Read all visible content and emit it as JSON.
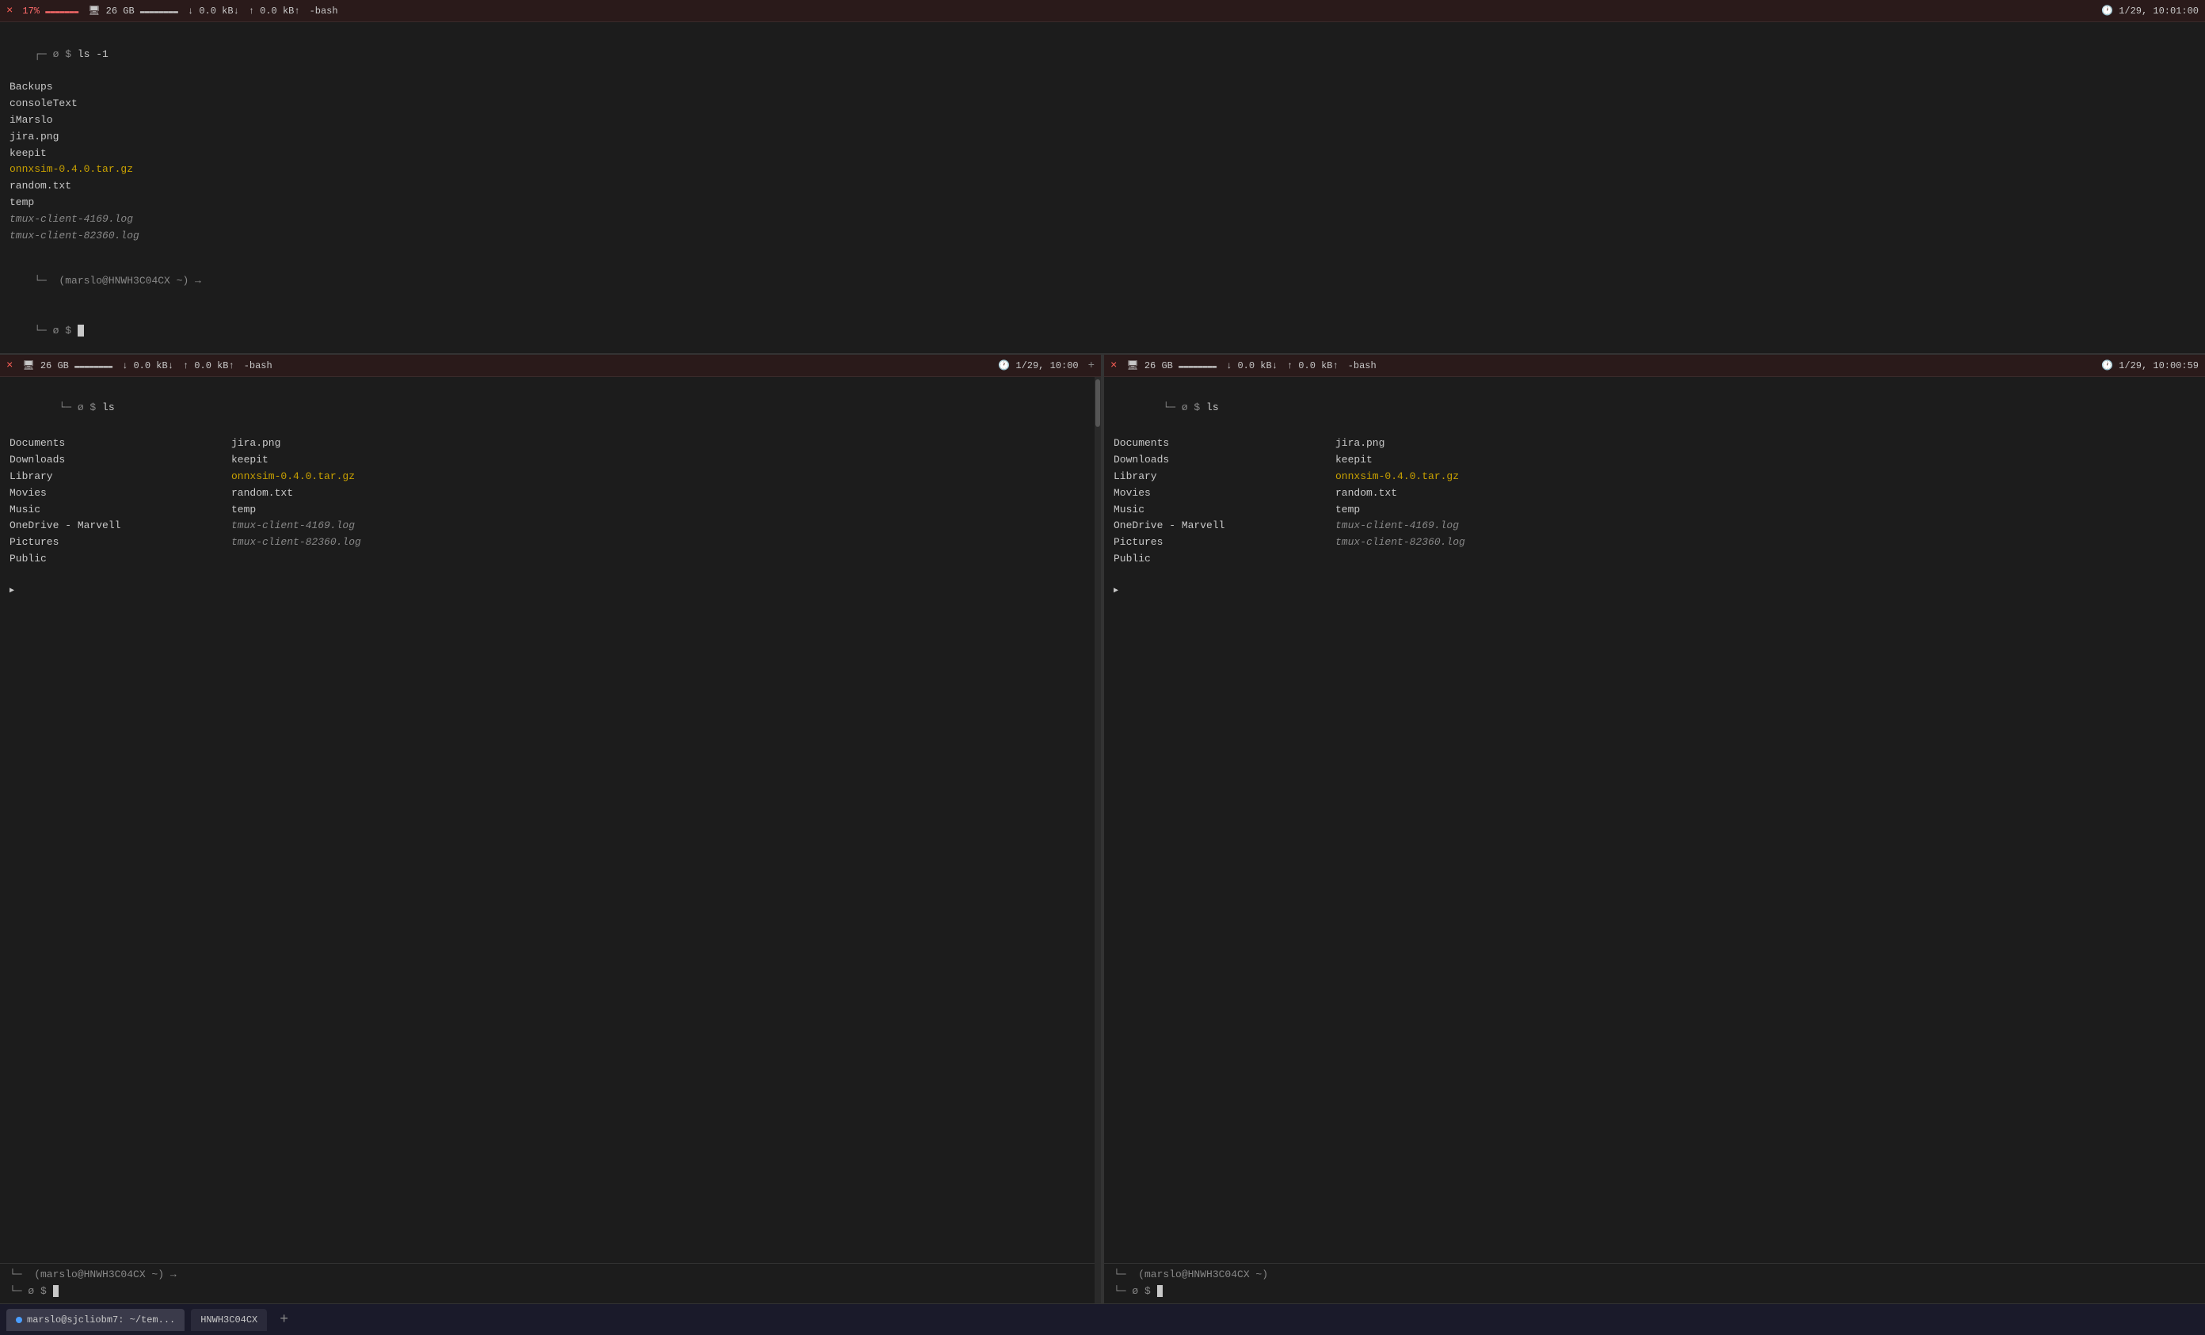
{
  "topbar": {
    "close_btn": "×",
    "cpu": "17%",
    "cpu_bar": "▬▬▬▬",
    "mem_label": "26 GB",
    "net_down": "0.0 kB↓",
    "net_up": "0.0 kB↑",
    "shell": "-bash",
    "timestamp": "1/29, 10:01:00"
  },
  "main_terminal": {
    "prompt1": "┌─ (ø $ ls -1",
    "files": [
      {
        "name": "Backups",
        "type": "dir"
      },
      {
        "name": "consoleText",
        "type": "dir"
      },
      {
        "name": "iMarslo",
        "type": "dir"
      },
      {
        "name": "jira.png",
        "type": "file"
      },
      {
        "name": "keepit",
        "type": "dir"
      },
      {
        "name": "onnxsim-0.4.0.tar.gz",
        "type": "gz"
      },
      {
        "name": "random.txt",
        "type": "file"
      },
      {
        "name": "temp",
        "type": "dir"
      },
      {
        "name": "tmux-client-4169.log",
        "type": "log"
      },
      {
        "name": "tmux-client-82360.log",
        "type": "log"
      }
    ],
    "prompt2": "└─ (marslo@HNWH3C04CX ~) →",
    "prompt3": "└─ ø $"
  },
  "pane_left": {
    "topbar": {
      "close_btn": "×",
      "mem_label": "26 GB",
      "net_down": "0.0 kB↓",
      "net_up": "0.0 kB↑",
      "shell": "-bash",
      "timestamp": "1/29, 10:00",
      "plus_btn": "+"
    },
    "cmd": "ls",
    "col1": [
      "Documents",
      "Downloads",
      "Library",
      "Movies",
      "Music",
      "OneDrive - Marvell",
      "Pictures",
      "Public"
    ],
    "col2_files": [
      {
        "name": "jira.png",
        "type": "file"
      },
      {
        "name": "keepit",
        "type": "dir"
      },
      {
        "name": "onnxsim-0.4.0.tar.gz",
        "type": "gz"
      },
      {
        "name": "random.txt",
        "type": "file"
      },
      {
        "name": "temp",
        "type": "dir"
      },
      {
        "name": "tmux-client-4169.log",
        "type": "log"
      },
      {
        "name": "tmux-client-82360.log",
        "type": "log"
      }
    ],
    "prompt": "└─  (marslo@HNWH3C04CX ~) →",
    "prompt2": "└─ ø $"
  },
  "pane_right": {
    "topbar": {
      "close_btn": "×",
      "mem_label": "26 GB",
      "net_down": "0.0 kB↓",
      "net_up": "0.0 kB↑",
      "shell": "-bash",
      "timestamp": "1/29, 10:00:59"
    },
    "cmd": "ls",
    "col1": [
      "Documents",
      "Downloads",
      "Library",
      "Movies",
      "Music",
      "OneDrive - Marvell",
      "Pictures",
      "Public"
    ],
    "col2_files": [
      {
        "name": "jira.png",
        "type": "file"
      },
      {
        "name": "keepit",
        "type": "dir"
      },
      {
        "name": "onnxsim-0.4.0.tar.gz",
        "type": "gz"
      },
      {
        "name": "random.txt",
        "type": "file"
      },
      {
        "name": "temp",
        "type": "dir"
      },
      {
        "name": "tmux-client-4169.log",
        "type": "log"
      },
      {
        "name": "tmux-client-82360.log",
        "type": "log"
      }
    ],
    "prompt": "└─  (marslo@HNWH3C04CX ~)",
    "prompt2": "└─ ø $"
  },
  "statusbar": {
    "tab1_label": "marslo@sjcliobm7: ~/tem...",
    "tab2_label": "HNWH3C04CX",
    "add_btn": "+"
  }
}
